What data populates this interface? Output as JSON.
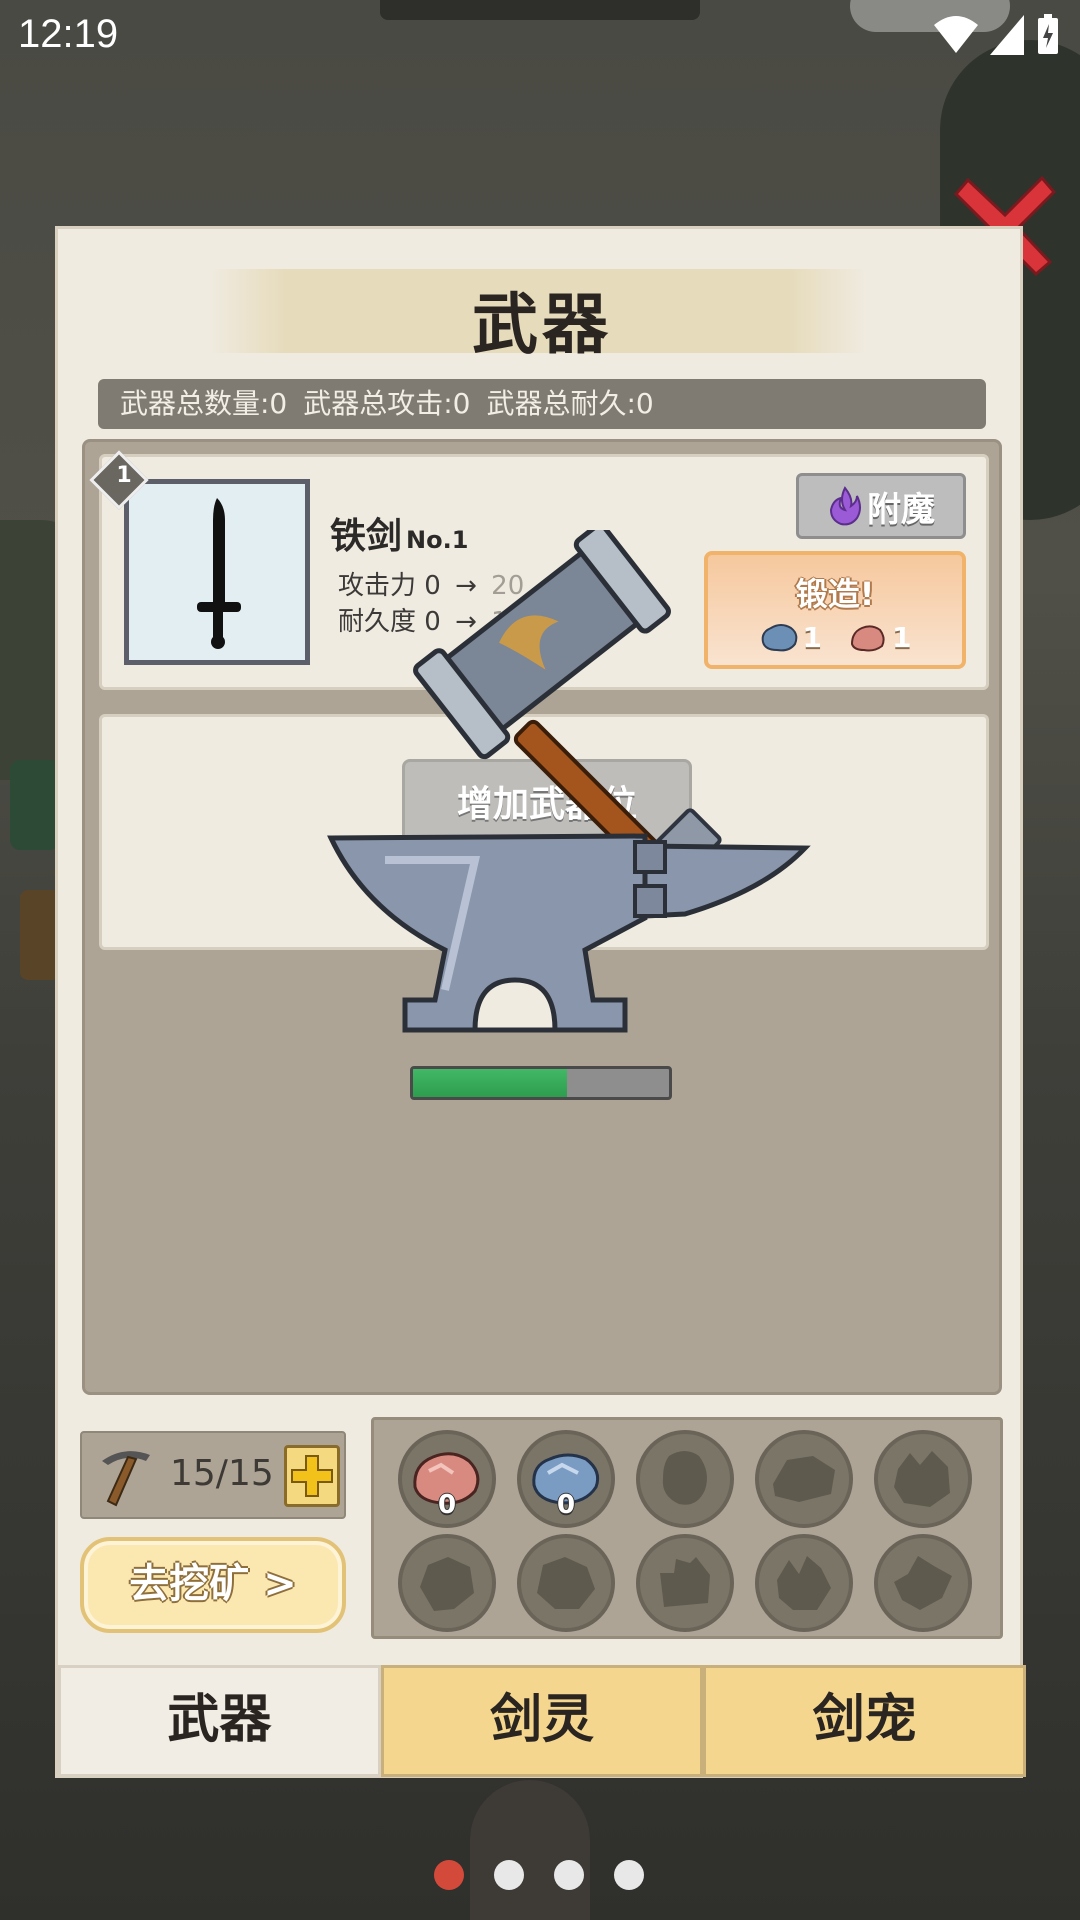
{
  "status": {
    "time": "12:19",
    "icons": [
      "wifi-icon",
      "signal-icon",
      "battery-icon"
    ]
  },
  "panel": {
    "title": "武器",
    "stats": {
      "total_count": "武器总数量:0",
      "total_attack": "武器总攻击:0",
      "total_durability": "武器总耐久:0"
    },
    "weapon_card": {
      "slot_number": "1",
      "name": "铁剑",
      "number": "No.1",
      "attack_label": "攻击力",
      "attack_current": "0",
      "attack_next": "20",
      "durability_label": "耐久度",
      "durability_current": "0",
      "durability_next": "100",
      "arrow": "→",
      "enchant_label": "附魔",
      "forge_label": "锻造!",
      "forge_cost_blue": "1",
      "forge_cost_red": "1"
    },
    "add_slot_label": "增加武器位",
    "forge_progress": 0.6
  },
  "mining": {
    "pickaxe_count": "15/15",
    "go_mine_label": "去挖矿 >"
  },
  "ores": [
    {
      "type": "red-ore",
      "count": "0",
      "owned": true
    },
    {
      "type": "blue-ore",
      "count": "0",
      "owned": true
    },
    {
      "type": "locked-ore-1",
      "count": "",
      "owned": false
    },
    {
      "type": "locked-ore-2",
      "count": "",
      "owned": false
    },
    {
      "type": "locked-ore-3",
      "count": "",
      "owned": false
    },
    {
      "type": "locked-ore-4",
      "count": "",
      "owned": false
    },
    {
      "type": "locked-ore-5",
      "count": "",
      "owned": false
    },
    {
      "type": "locked-ore-6",
      "count": "",
      "owned": false
    },
    {
      "type": "locked-ore-7",
      "count": "",
      "owned": false
    },
    {
      "type": "locked-ore-8",
      "count": "",
      "owned": false
    }
  ],
  "tabs": [
    {
      "label": "武器",
      "active": true
    },
    {
      "label": "剑灵",
      "active": false
    },
    {
      "label": "剑宠",
      "active": false
    }
  ],
  "page_dots": {
    "count": 4,
    "active_index": 0
  },
  "colors": {
    "accent_red": "#d44a3a",
    "progress_green": "#2d9d4e",
    "tab_gold": "#f4d68f",
    "panel_bg": "#f0ebe1"
  }
}
